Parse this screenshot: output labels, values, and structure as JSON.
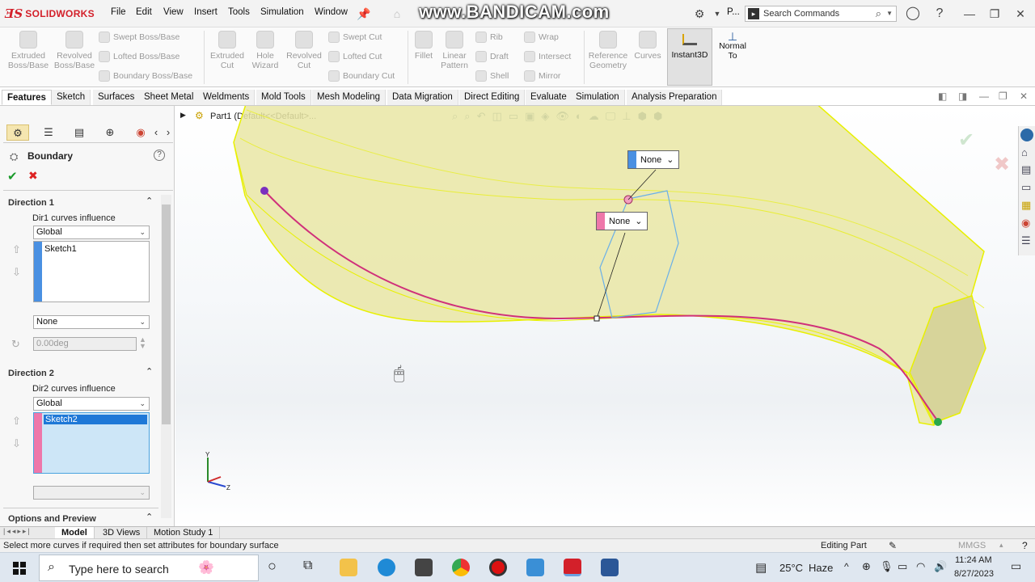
{
  "titlebar": {
    "brand": "SOLIDWORKS",
    "menus": [
      "File",
      "Edit",
      "View",
      "Insert",
      "Tools",
      "Simulation",
      "Window"
    ],
    "watermark": "www.BANDICAM.com",
    "profile_short": "P...",
    "search_placeholder": "Search Commands"
  },
  "command_manager": {
    "big": [
      {
        "label1": "Extruded",
        "label2": "Boss/Base"
      },
      {
        "label1": "Revolved",
        "label2": "Boss/Base"
      },
      {
        "label1": "Extruded",
        "label2": "Cut"
      },
      {
        "label1": "Hole",
        "label2": "Wizard"
      },
      {
        "label1": "Revolved",
        "label2": "Cut"
      },
      {
        "label1": "Fillet",
        "label2": ""
      },
      {
        "label1": "Linear",
        "label2": "Pattern"
      },
      {
        "label1": "Reference",
        "label2": "Geometry"
      },
      {
        "label1": "Curves",
        "label2": ""
      }
    ],
    "small": [
      "Swept Boss/Base",
      "Lofted Boss/Base",
      "Boundary Boss/Base",
      "Swept Cut",
      "Lofted Cut",
      "Boundary Cut",
      "Rib",
      "Draft",
      "Shell",
      "Wrap",
      "Intersect",
      "Mirror"
    ],
    "instant3d": "Instant3D",
    "normal_to_1": "Normal",
    "normal_to_2": "To"
  },
  "tabs": [
    "Features",
    "Sketch",
    "Surfaces",
    "Sheet Metal",
    "Weldments",
    "Mold Tools",
    "Mesh Modeling",
    "Data Migration",
    "Direct Editing",
    "Evaluate",
    "Simulation",
    "Analysis Preparation"
  ],
  "property_manager": {
    "title": "Boundary",
    "direction1": {
      "title": "Direction 1",
      "influence_label": "Dir1 curves influence",
      "influence_value": "Global",
      "curve": "Sketch1",
      "tangency": "None",
      "angle": "0.00deg"
    },
    "direction2": {
      "title": "Direction 2",
      "influence_label": "Dir2 curves influence",
      "influence_value": "Global",
      "curve": "Sketch2"
    },
    "options_title": "Options and Preview"
  },
  "graphics": {
    "tree_root": "Part1  (Default<<Default>...",
    "callout1": "None",
    "callout2": "None",
    "triad_y": "Y",
    "triad_z": "Z",
    "colors": {
      "dir1": "#4a90e2",
      "dir2": "#ee77aa",
      "surface": "#e9e6a4",
      "edge": "#e8f000",
      "curve": "#d0307a"
    }
  },
  "bottom_tabs": [
    "Model",
    "3D Views",
    "Motion Study 1"
  ],
  "status": {
    "message": "Select more curves if required then set attributes for boundary surface",
    "mode": "Editing Part",
    "units": "MMGS"
  },
  "taskbar": {
    "search_placeholder": "Type here to search",
    "weather_temp": "25°C",
    "weather_desc": "Haze",
    "time": "11:24 AM",
    "date": "8/27/2023"
  }
}
